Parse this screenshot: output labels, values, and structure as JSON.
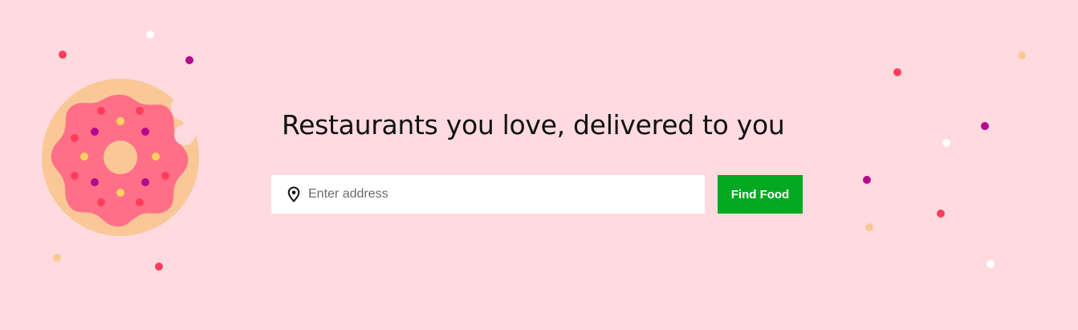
{
  "hero": {
    "headline": "Restaurants you love, delivered to you",
    "background_color": "#ffdbe0"
  },
  "search": {
    "icon": "location-pin-icon",
    "placeholder": "Enter address",
    "value": "",
    "button_label": "Find Food",
    "button_color": "#05a921"
  },
  "illustration": {
    "icon": "donut-illustration",
    "dough_color": "#f9c896",
    "frosting_color": "#ff7088",
    "sprinkle_colors": [
      "#ff3d5a",
      "#b4088e",
      "#ffd35c"
    ]
  },
  "decor": {
    "confetti_colors": [
      "#ff3d5a",
      "#b4088e",
      "#ffffff",
      "#f9c896"
    ]
  }
}
